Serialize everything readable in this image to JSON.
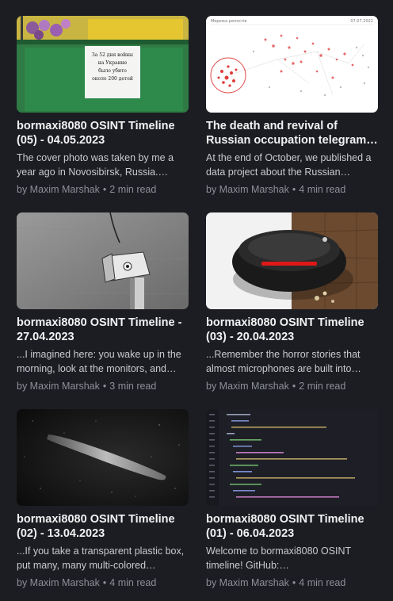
{
  "posts": [
    {
      "title": "bormaxi8080 OSINT Timeline (05) - 04.05.2023",
      "excerpt": "The cover photo was taken by me a year ago in Novosibirsk, Russia.…",
      "author": "by Maxim Marshak",
      "separator": "•",
      "read_time": "2 min read",
      "thumb_sign_text": [
        "За 52 дня войны",
        "на Украине",
        "было убито",
        "около 200 детей"
      ]
    },
    {
      "title": "The death and revival of Russian occupation telegram…",
      "excerpt": "At the end of October, we published a data project about the Russian…",
      "author": "by Maxim Marshak",
      "separator": "•",
      "read_time": "4 min read",
      "thumb_header_left": "Мережа репостів",
      "thumb_header_right": "07.07.2022"
    },
    {
      "title": "bormaxi8080 OSINT Timeline - 27.04.2023",
      "excerpt": "...I imagined here: you wake up in the morning, look at the monitors, and…",
      "author": "by Maxim Marshak",
      "separator": "•",
      "read_time": "3 min read"
    },
    {
      "title": "bormaxi8080 OSINT Timeline (03) - 20.04.2023",
      "excerpt": "...Remember the horror stories that almost microphones are built into…",
      "author": "by Maxim Marshak",
      "separator": "•",
      "read_time": "2 min read"
    },
    {
      "title": "bormaxi8080 OSINT Timeline (02) - 13.04.2023",
      "excerpt": "...If you take a transparent plastic box, put many, many multi-colored…",
      "author": "by Maxim Marshak",
      "separator": "•",
      "read_time": "4 min read"
    },
    {
      "title": "bormaxi8080 OSINT Timeline (01) - 06.04.2023",
      "excerpt": "Welcome to bormaxi8080 OSINT timeline! GitHub:…",
      "author": "by Maxim Marshak",
      "separator": "•",
      "read_time": "4 min read"
    }
  ],
  "colors": {
    "background": "#1c1d22",
    "title": "#f2f2f4",
    "excerpt": "#c9cad0",
    "meta": "#8d8f98"
  }
}
